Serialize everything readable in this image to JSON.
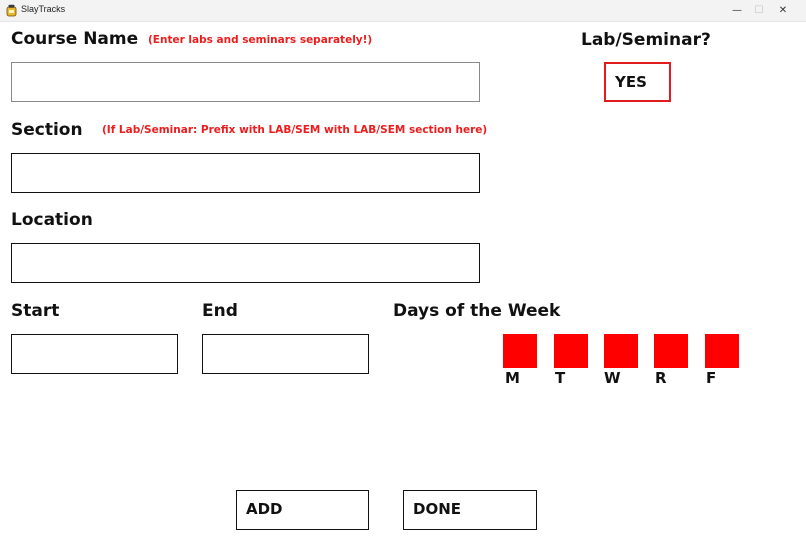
{
  "window": {
    "title": "SlayTracks",
    "minimize": "—",
    "maximize": "☐",
    "close": "✕"
  },
  "form": {
    "course_name_label": "Course Name",
    "course_name_hint": "(Enter labs and seminars separately!)",
    "course_name_value": "",
    "section_label": "Section",
    "section_hint": "(If Lab/Seminar: Prefix with LAB/SEM with LAB/SEM section here)",
    "section_value": "",
    "location_label": "Location",
    "location_value": "",
    "start_label": "Start",
    "start_value": "",
    "end_label": "End",
    "end_value": "",
    "lab_seminar_label": "Lab/Seminar?",
    "lab_seminar_button": "YES",
    "days_label": "Days of the Week",
    "days": [
      "M",
      "T",
      "W",
      "R",
      "F"
    ]
  },
  "actions": {
    "add": "ADD",
    "done": "DONE"
  },
  "colors": {
    "accent_red": "#ff0000",
    "hint_red": "#ee1c1c",
    "text": "#111111"
  }
}
